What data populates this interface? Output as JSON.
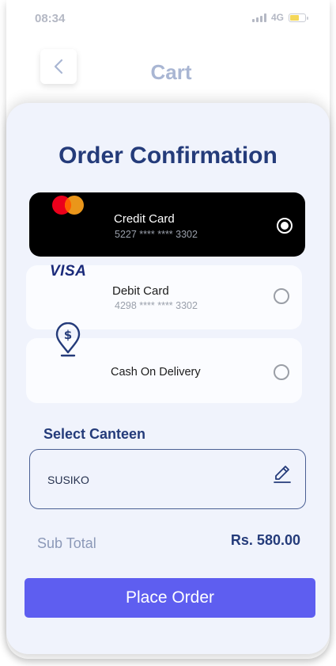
{
  "status_bar": {
    "time": "08:34",
    "network": "4G",
    "battery_level": 0.6
  },
  "header": {
    "title": "Cart"
  },
  "main": {
    "title": "Order Confirmation",
    "payment_methods": [
      {
        "label": "Credit Card",
        "number": "5227 **** **** 3302",
        "icon": "mastercard-logo",
        "selected": true
      },
      {
        "label": "Debit Card",
        "number": "4298 **** **** 3302",
        "brand_text": "VISA",
        "icon": "visa-logo",
        "selected": false
      },
      {
        "label": "Cash On Delivery",
        "icon": "cash-location-icon",
        "selected": false
      }
    ],
    "canteen": {
      "label": "Select Canteen",
      "value": "SUSIKO"
    },
    "subtotal": {
      "label": "Sub Total",
      "value": "Rs. 580.00"
    },
    "place_order_label": "Place Order"
  },
  "colors": {
    "accent": "#5e5ef0",
    "title": "#243b7a",
    "sheet_bg": "#f0f3fc",
    "selected_card": "#000000",
    "mastercard_red": "#eb001b",
    "mastercard_orange": "#f79e1b"
  }
}
